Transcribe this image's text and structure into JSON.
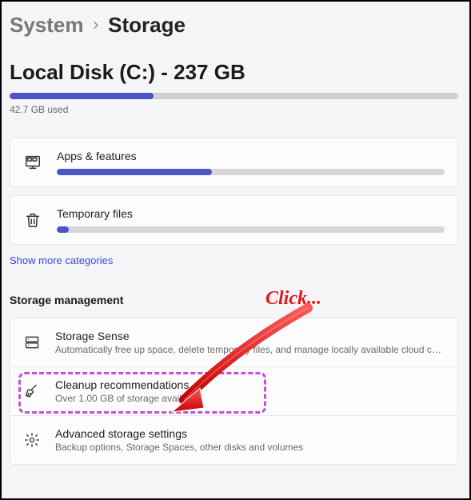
{
  "breadcrumb": {
    "parent": "System",
    "sep": "›",
    "current": "Storage"
  },
  "disk": {
    "title": "Local Disk (C:) - 237 GB",
    "used_label": "42.7 GB used",
    "bar_percent": 32
  },
  "categories": [
    {
      "icon": "apps-icon",
      "title": "Apps & features",
      "bar_percent": 40
    },
    {
      "icon": "trash-icon",
      "title": "Temporary files",
      "bar_percent": 3
    }
  ],
  "show_more_label": "Show more categories",
  "management_section_title": "Storage management",
  "management": [
    {
      "icon": "drive-icon",
      "title": "Storage Sense",
      "desc": "Automatically free up space, delete temporary files, and manage locally available cloud content",
      "highlighted": false
    },
    {
      "icon": "broom-icon",
      "title": "Cleanup recommendations",
      "desc": "Over 1.00 GB of storage available.",
      "highlighted": true
    },
    {
      "icon": "gear-icon",
      "title": "Advanced storage settings",
      "desc": "Backup options, Storage Spaces, other disks and volumes",
      "highlighted": false
    }
  ],
  "annotation": {
    "label": "Click..."
  },
  "colors": {
    "accent": "#4a55c8",
    "highlight": "#c44fd6",
    "annot": "#e11818"
  }
}
